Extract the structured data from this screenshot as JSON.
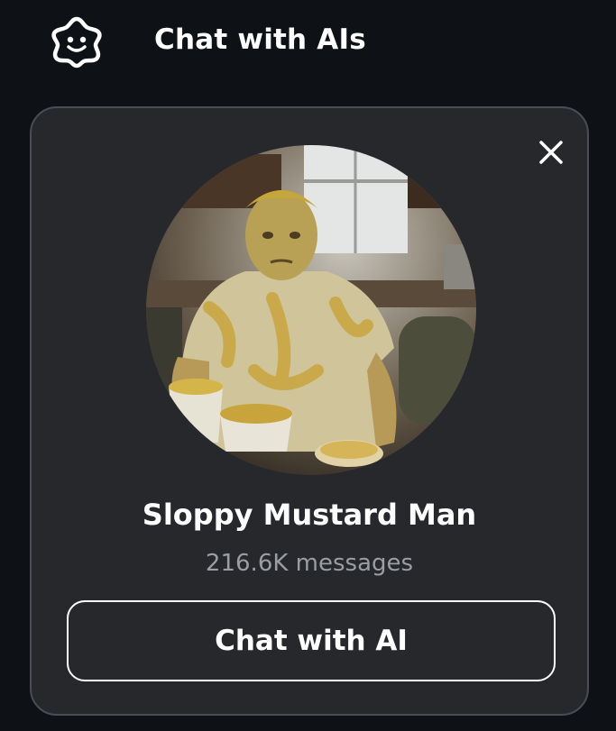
{
  "header": {
    "logo_icon": "smiley-star-logo-icon",
    "title": "Chat with AIs"
  },
  "card": {
    "close_icon": "close-icon",
    "avatar_alt": "character-avatar",
    "character_name": "Sloppy Mustard Man",
    "message_count": "216.6K messages",
    "chat_button_label": "Chat with AI"
  },
  "colors": {
    "page_background": "#0e1116",
    "card_background": "#26282c",
    "card_border": "#4a4d53",
    "secondary_text": "#9a9da3",
    "primary_text": "#ffffff"
  }
}
